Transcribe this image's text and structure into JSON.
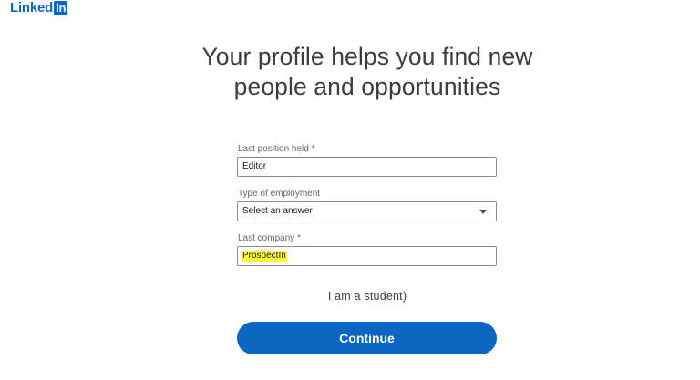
{
  "header": {
    "logo_text": "Linked",
    "logo_box": "in",
    "brand_color": "#0a66c2"
  },
  "headline": {
    "line1": "Your profile helps you find new",
    "line2": "people and opportunities"
  },
  "form": {
    "position": {
      "label": "Last position held *",
      "value": "Editor"
    },
    "employment_type": {
      "label": "Type of employment",
      "value": "Select an answer",
      "icon": "chevron-down-icon"
    },
    "company": {
      "label": "Last company *",
      "value": "ProspectIn",
      "highlight_color": "#ffff33"
    }
  },
  "student_link": "I am a student)",
  "continue_button": "Continue"
}
